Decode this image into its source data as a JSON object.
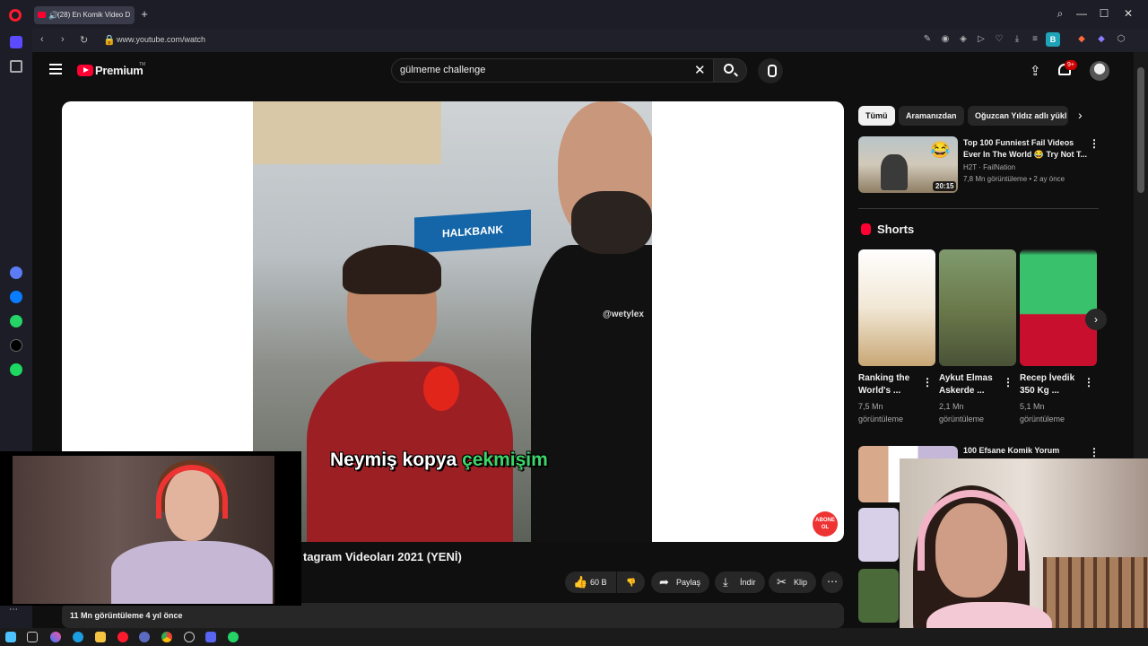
{
  "browser": {
    "tab_title": "(28) En Komik Video D",
    "url": "www.youtube.com/watch",
    "new_tab": "+",
    "account_initial": "B"
  },
  "header": {
    "brand": "Premium",
    "brand_tm": "TM",
    "search_value": "gülmeme challenge",
    "notification_count": "9+"
  },
  "player": {
    "subtitle_part1": "Neymiş kopya ",
    "subtitle_highlight": "çekmişim",
    "watermark": "@wetylex",
    "bank_sign": "HALKBANK",
    "subscribe_badge": "ABONE OL"
  },
  "video": {
    "title": "tagram Videoları 2021 (YENİ)",
    "likes": "60 B",
    "share": "Paylaş",
    "download": "İndir",
    "clip": "Klip",
    "views": "11 Mn görüntüleme  4 yıl önce"
  },
  "chips": [
    "Tümü",
    "Aramanızdan",
    "Oğuzcan Yıldız adlı yükl"
  ],
  "recommended": {
    "title": "Top 100 Funniest Fail Videos Ever In The World 😂 Try Not T...",
    "channel": "H2T · FailNation",
    "meta": "7,8 Mn görüntüleme • 2 ay önce",
    "duration": "20:15"
  },
  "shorts": {
    "heading": "Shorts",
    "items": [
      {
        "title": "Ranking the World's ...",
        "views": "7,5 Mn görüntüleme"
      },
      {
        "title": "Aykut Elmas Askerde ...",
        "views": "2,1 Mn görüntüleme"
      },
      {
        "title": "Recep İvedik 350 Kg ...",
        "views": "5,1 Mn görüntüleme"
      }
    ]
  },
  "recommended2": {
    "title": "100 Efsane Komik Yorum"
  },
  "colors": {
    "accent": "#ff0033",
    "background": "#0f0f0f"
  }
}
